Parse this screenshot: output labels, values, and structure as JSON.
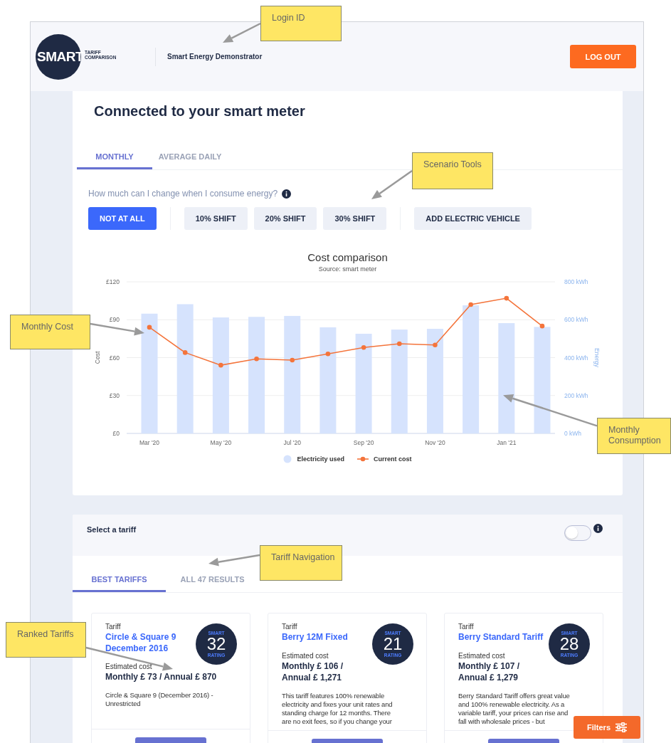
{
  "header": {
    "logo": {
      "word": "SMART",
      "tagline_1": "TARIFF",
      "tagline_2": "COMPARISON"
    },
    "login_id": "Smart Energy Demonstrator",
    "logout": "LOG OUT"
  },
  "meter": {
    "title": "Connected to your smart meter",
    "tabs": [
      {
        "label": "MONTHLY",
        "selected": true
      },
      {
        "label": "AVERAGE DAILY",
        "selected": false
      }
    ],
    "question": "How much can I change when I consume energy?",
    "scenarios": [
      {
        "label": "NOT AT ALL",
        "selected": true,
        "divider_before": false
      },
      {
        "label": "10% SHIFT",
        "selected": false,
        "divider_before": true
      },
      {
        "label": "20% SHIFT",
        "selected": false,
        "divider_before": false
      },
      {
        "label": "30% SHIFT",
        "selected": false,
        "divider_before": false
      },
      {
        "label": "ADD ELECTRIC VEHICLE",
        "selected": false,
        "divider_before": true
      }
    ],
    "chart_data": {
      "type": "bar",
      "title": "Cost comparison",
      "subtitle": "Source: smart meter",
      "ylabel": "Cost",
      "y2label": "Energy",
      "categories": [
        "Mar '20",
        null,
        "May '20",
        null,
        "Jul '20",
        null,
        "Sep '20",
        null,
        "Nov '20",
        null,
        "Jan '21",
        null
      ],
      "grid": true,
      "ylim": [
        0,
        120
      ],
      "yticks": [
        {
          "value": 0,
          "label": "£0"
        },
        {
          "value": 30,
          "label": "£30"
        },
        {
          "value": 60,
          "label": "£60"
        },
        {
          "value": 90,
          "label": "£90"
        },
        {
          "value": 120,
          "label": "£120"
        }
      ],
      "y2lim": [
        0,
        800
      ],
      "y2ticks": [
        {
          "value": 0,
          "label": "0 kWh"
        },
        {
          "value": 200,
          "label": "200 kWh"
        },
        {
          "value": 400,
          "label": "400 kWh"
        },
        {
          "value": 600,
          "label": "600 kWh"
        },
        {
          "value": 800,
          "label": "800 kWh"
        }
      ],
      "series": [
        {
          "name": "Electricity used",
          "type": "bar",
          "axis": "y2",
          "color": "#d6e3fd",
          "values": [
            632,
            682,
            612,
            615,
            620,
            560,
            526,
            548,
            552,
            676,
            582,
            562
          ]
        },
        {
          "name": "Current cost",
          "type": "line",
          "axis": "y",
          "marker": "circle",
          "color": "#f4743b",
          "values": [
            84,
            64,
            54,
            59,
            58,
            63,
            68,
            71,
            70,
            102,
            107,
            85
          ]
        }
      ]
    }
  },
  "tariffs": {
    "title": "Select a tariff",
    "toggle": {
      "on": false
    },
    "tabs": [
      {
        "label": "BEST TARIFFS",
        "selected": true
      },
      {
        "label": "ALL 47 RESULTS",
        "selected": false
      }
    ],
    "cards": [
      {
        "label": "Tariff",
        "name": "Circle & Square 9\nDecember 2016",
        "rating_top": "SMART",
        "rating": "32",
        "rating_bottom": "RATING",
        "cost_label": "Estimated cost",
        "cost": "Monthly £ 73 / Annual £ 870",
        "description": "Circle & Square 9 (December 2016) - Unrestricted"
      },
      {
        "label": "Tariff",
        "name": "Berry 12M Fixed",
        "rating_top": "SMART",
        "rating": "21",
        "rating_bottom": "RATING",
        "cost_label": "Estimated cost",
        "cost": "Monthly £ 106 /\nAnnual £ 1,271",
        "description": "This tariff features 100% renewable\nelectricity and fixes your unit rates and\nstanding charge for 12 months. There\nare no exit fees, so if you change your"
      },
      {
        "label": "Tariff",
        "name": "Berry Standard Tariff",
        "rating_top": "SMART",
        "rating": "28",
        "rating_bottom": "RATING",
        "cost_label": "Estimated cost",
        "cost": "Monthly £ 107 /\nAnnual £ 1,279",
        "description": "Berry Standard Tariff offers great value\nand 100% renewable electricity. As a\nvariable tariff, your prices can rise and\nfall with wholesale prices - but"
      }
    ],
    "filters": "Filters"
  },
  "callouts": [
    {
      "text": "Login ID"
    },
    {
      "text": "Scenario Tools"
    },
    {
      "text": "Monthly Cost"
    },
    {
      "text": "Monthly Consumption"
    },
    {
      "text": "Tariff Navigation"
    },
    {
      "text": "Ranked Tariffs"
    }
  ]
}
